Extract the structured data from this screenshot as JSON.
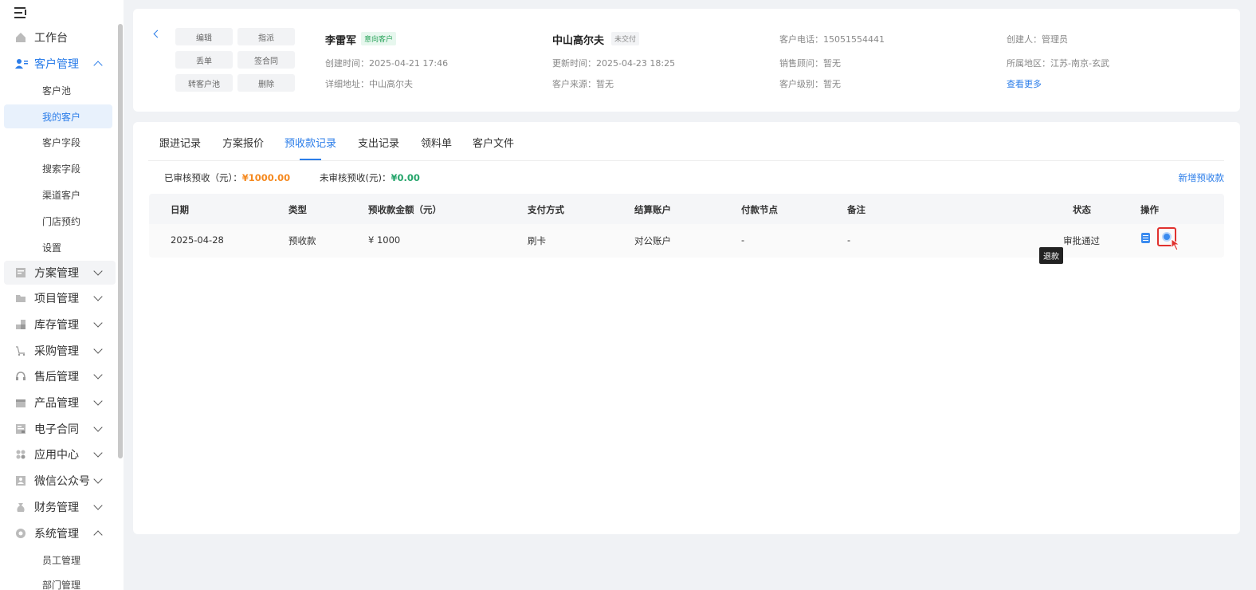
{
  "sidebar": {
    "items": [
      {
        "label": "工作台",
        "icon": "home-icon"
      },
      {
        "label": "客户管理",
        "icon": "customer-icon",
        "expanded": true,
        "children": [
          "客户池",
          "我的客户",
          "客户字段",
          "搜索字段",
          "渠道客户",
          "门店预约",
          "设置"
        ]
      },
      {
        "label": "方案管理",
        "icon": "plan-icon"
      },
      {
        "label": "项目管理",
        "icon": "folder-icon"
      },
      {
        "label": "库存管理",
        "icon": "inventory-icon"
      },
      {
        "label": "采购管理",
        "icon": "cart-icon"
      },
      {
        "label": "售后管理",
        "icon": "headset-icon"
      },
      {
        "label": "产品管理",
        "icon": "box-icon"
      },
      {
        "label": "电子合同",
        "icon": "contract-icon"
      },
      {
        "label": "应用中心",
        "icon": "apps-icon"
      },
      {
        "label": "微信公众号",
        "icon": "wechat-icon"
      },
      {
        "label": "财务管理",
        "icon": "money-bag-icon"
      },
      {
        "label": "系统管理",
        "icon": "settings-icon",
        "expanded": true,
        "children": [
          "员工管理",
          "部门管理"
        ]
      }
    ],
    "active_child": "我的客户"
  },
  "header": {
    "buttons": [
      "编辑",
      "指派",
      "丢单",
      "签合同",
      "转客户池",
      "删除"
    ],
    "customer_name": "李雷军",
    "customer_tag": "意向客户",
    "project_name": "中山高尔夫",
    "project_tag": "未交付",
    "created": "创建时间：2025-04-21 17:46",
    "address": "详细地址：中山高尔夫",
    "updated": "更新时间：2025-04-23 18:25",
    "source": "客户来源：暂无",
    "phone": "客户电话：15051554441",
    "sales": "销售顾问：暂无",
    "level": "客户级别：暂无",
    "creator": "创建人：管理员",
    "region": "所属地区：江苏-南京-玄武",
    "more_link": "查看更多"
  },
  "tabs": [
    "跟进记录",
    "方案报价",
    "预收款记录",
    "支出记录",
    "领料单",
    "客户文件"
  ],
  "active_tab": "预收款记录",
  "summary": {
    "approved_label": "已审核预收（元）：",
    "approved_value": "¥1000.00",
    "pending_label": "未审核预收(元)：",
    "pending_value": "¥0.00",
    "new_link": "新增预收款"
  },
  "table": {
    "columns": [
      "日期",
      "类型",
      "预收款金额（元）",
      "支付方式",
      "结算账户",
      "付款节点",
      "备注",
      "状态",
      "操作"
    ],
    "rows": [
      [
        "2025-04-28",
        "预收款",
        "¥ 1000",
        "刷卡",
        "对公账户",
        "-",
        "-",
        "审批通过"
      ]
    ],
    "tooltip": "退款"
  },
  "colors": {
    "accent": "#2b7de9",
    "orange": "#f5891f",
    "green": "#25a56b",
    "highlight": "#e0312e"
  }
}
